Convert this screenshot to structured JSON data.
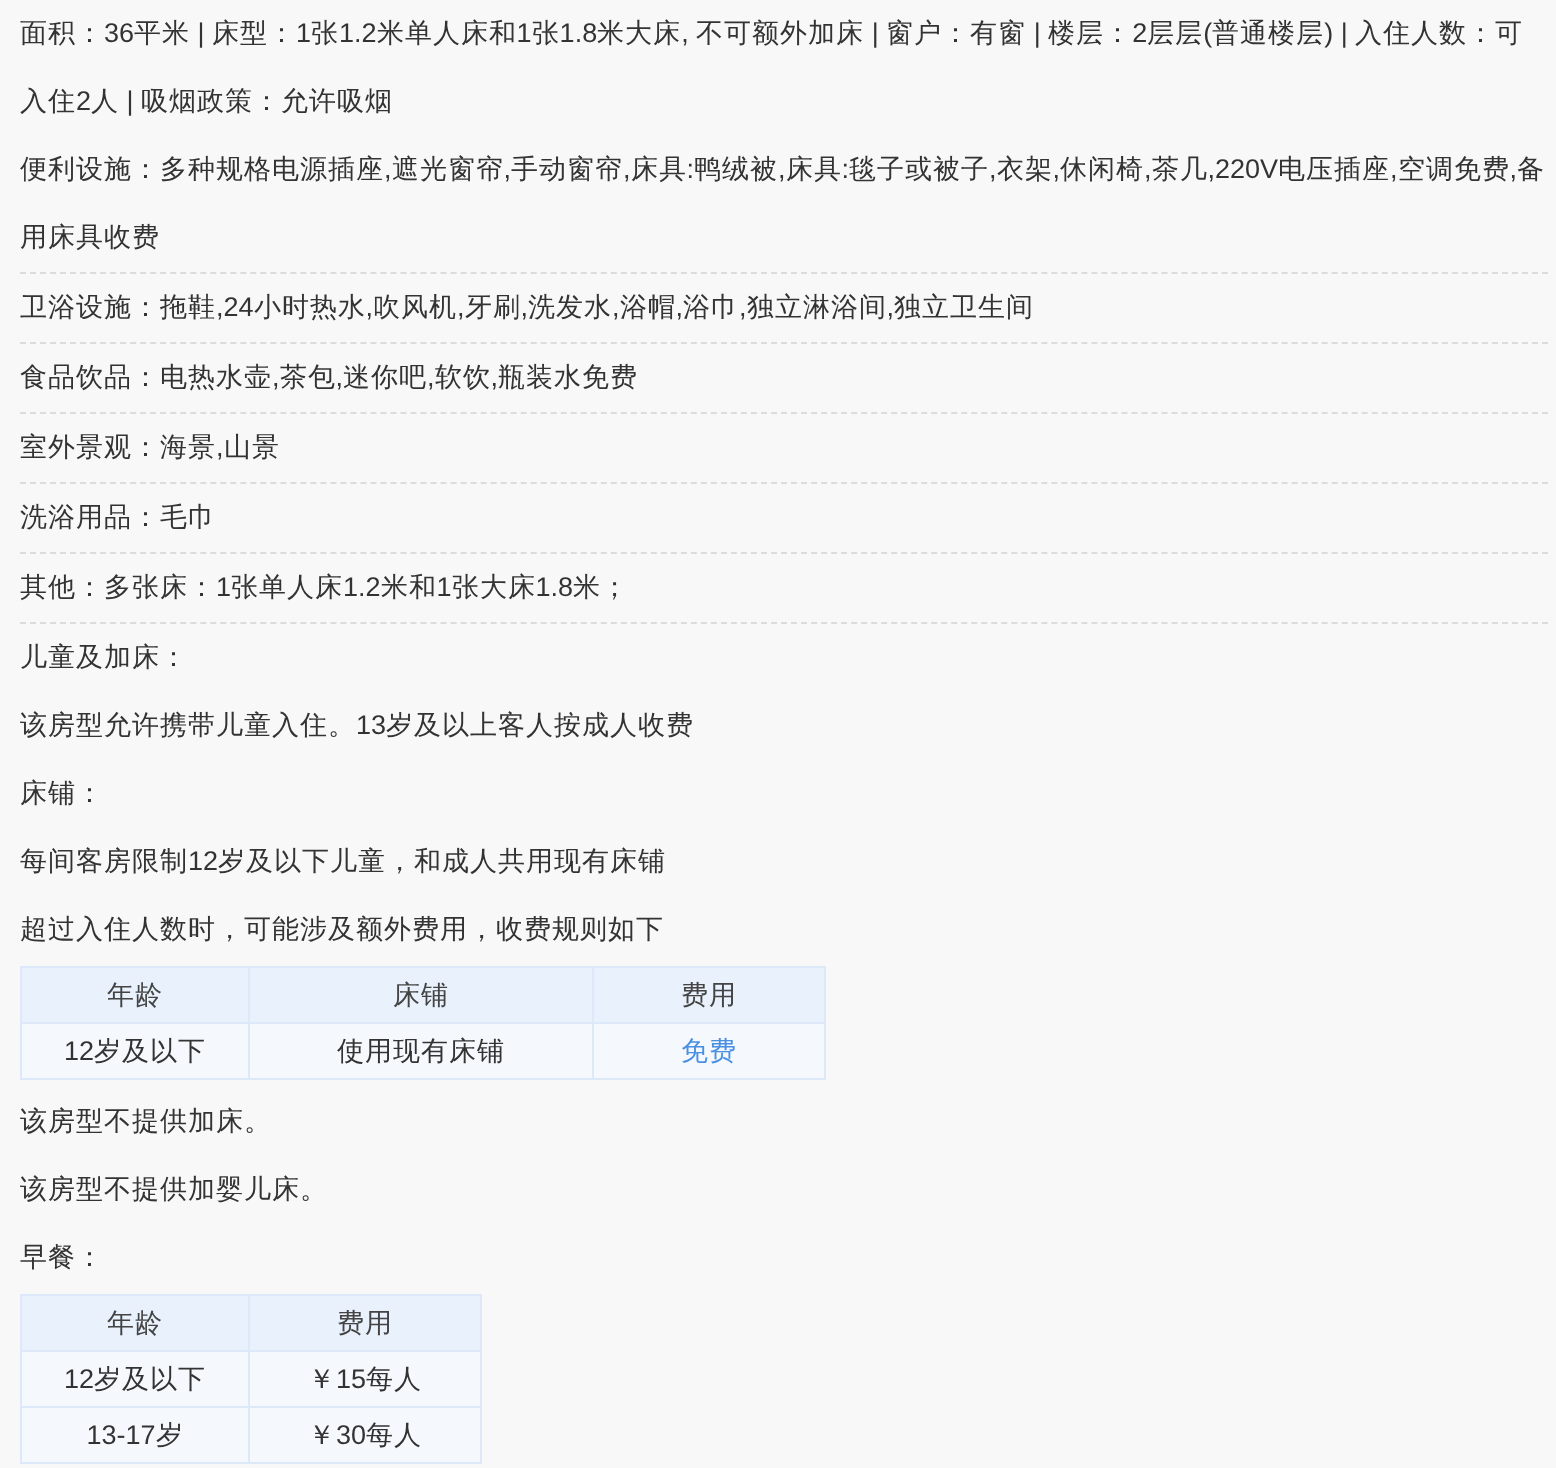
{
  "blocks": [
    {
      "kind": "paragraph",
      "text": "面积：36平米 | 床型：1张1.2米单人床和1张1.8米大床, 不可额外加床 | 窗户：有窗 | 楼层：2层层(普通楼层) | 入住人数：可入住2人 | 吸烟政策：允许吸烟",
      "divider_below": false
    },
    {
      "kind": "paragraph",
      "text": "便利设施：多种规格电源插座,遮光窗帘,手动窗帘,床具:鸭绒被,床具:毯子或被子,衣架,休闲椅,茶几,220V电压插座,空调免费,备用床具收费",
      "divider_below": true
    },
    {
      "kind": "paragraph",
      "text": "卫浴设施：拖鞋,24小时热水,吹风机,牙刷,洗发水,浴帽,浴巾,独立淋浴间,独立卫生间",
      "divider_below": true
    },
    {
      "kind": "paragraph",
      "text": "食品饮品：电热水壶,茶包,迷你吧,软饮,瓶装水免费",
      "divider_below": true
    },
    {
      "kind": "paragraph",
      "text": "室外景观：海景,山景",
      "divider_below": true
    },
    {
      "kind": "paragraph",
      "text": "洗浴用品：毛巾",
      "divider_below": true
    },
    {
      "kind": "paragraph",
      "text": "其他：多张床：1张单人床1.2米和1张大床1.8米；",
      "divider_below": true
    },
    {
      "kind": "paragraph",
      "text": "儿童及加床：",
      "divider_below": false
    },
    {
      "kind": "paragraph",
      "text": "该房型允许携带儿童入住。13岁及以上客人按成人收费",
      "divider_below": false
    },
    {
      "kind": "paragraph",
      "text": "床铺：",
      "divider_below": false
    },
    {
      "kind": "paragraph",
      "text": "每间客房限制12岁及以下儿童，和成人共用现有床铺",
      "divider_below": false
    },
    {
      "kind": "paragraph",
      "text": "超过入住人数时，可能涉及额外费用，收费规则如下",
      "divider_below": false
    },
    {
      "kind": "table",
      "columns": [
        "年龄",
        "床铺",
        "费用"
      ],
      "rows": [
        [
          {
            "text": "12岁及以下",
            "kind": "plain"
          },
          {
            "text": "使用现有床铺",
            "kind": "plain"
          },
          {
            "text": "免费",
            "kind": "free"
          }
        ]
      ]
    },
    {
      "kind": "paragraph",
      "text": "该房型不提供加床。",
      "divider_below": false
    },
    {
      "kind": "paragraph",
      "text": "该房型不提供加婴儿床。",
      "divider_below": false
    },
    {
      "kind": "paragraph",
      "text": "早餐：",
      "divider_below": false
    },
    {
      "kind": "table",
      "columns": [
        "年龄",
        "费用"
      ],
      "rows": [
        [
          {
            "text": "12岁及以下",
            "kind": "plain"
          },
          {
            "text": "￥15每人",
            "kind": "plain"
          }
        ],
        [
          {
            "text": "13-17岁",
            "kind": "plain"
          },
          {
            "text": "￥30每人",
            "kind": "plain"
          }
        ]
      ]
    }
  ]
}
